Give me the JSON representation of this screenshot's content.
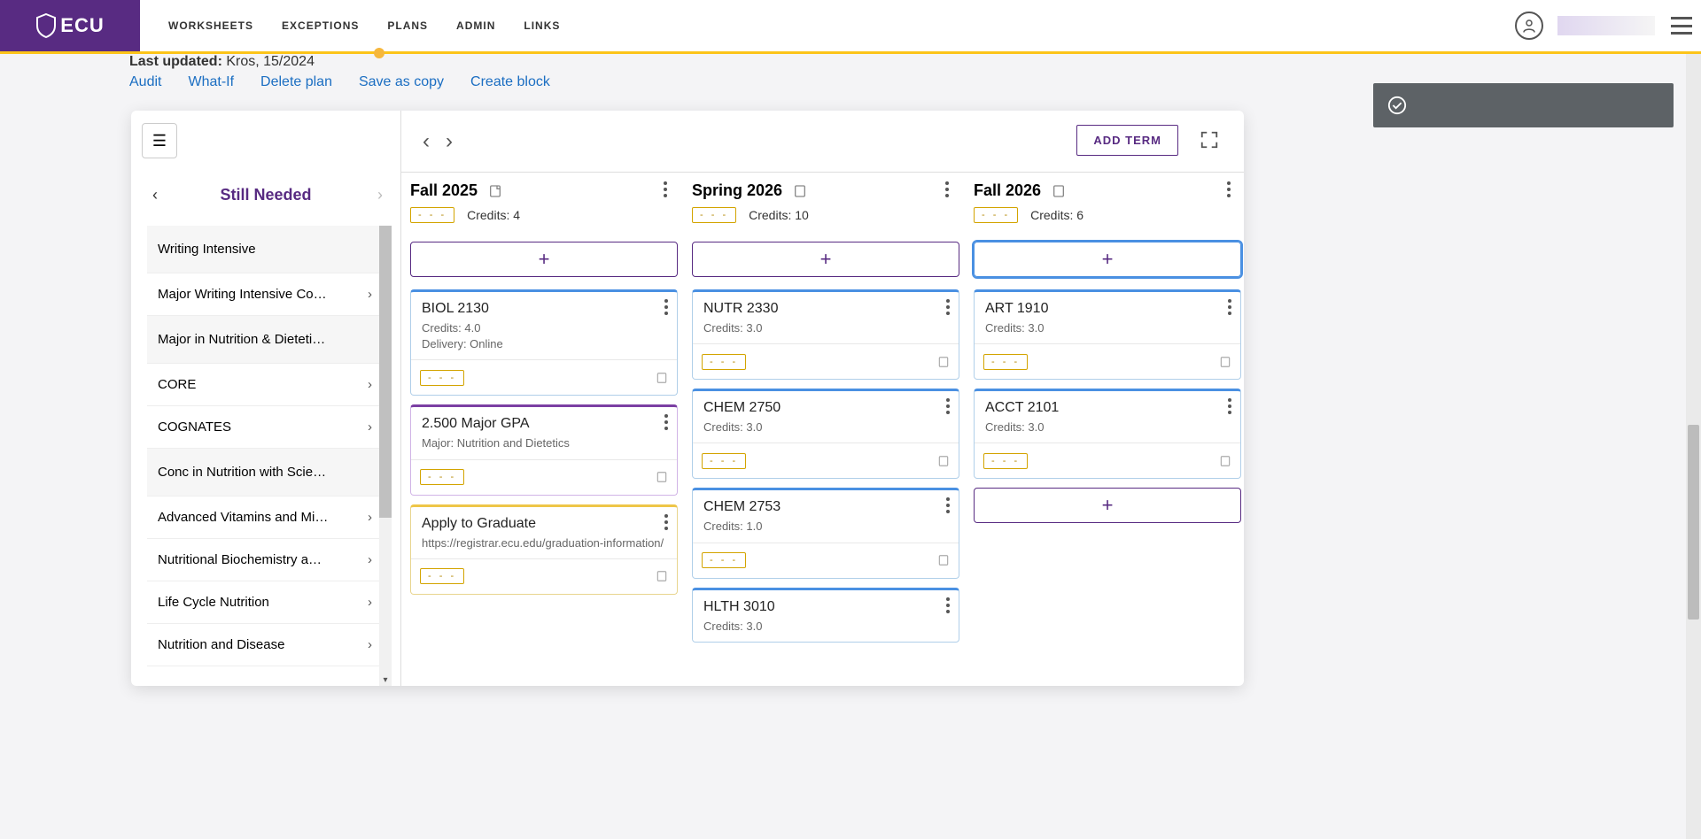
{
  "brand": {
    "text": "ECU"
  },
  "nav": {
    "worksheets": "WORKSHEETS",
    "exceptions": "EXCEPTIONS",
    "plans": "PLANS",
    "admin": "ADMIN",
    "links": "LINKS"
  },
  "subheader": {
    "last_updated_label": "Last updated:",
    "last_updated_value": "Kros,                           15/2024"
  },
  "actions": {
    "audit": "Audit",
    "whatif": "What-If",
    "delete": "Delete plan",
    "save": "Save as copy",
    "create": "Create block"
  },
  "sidebar": {
    "title": "Still Needed",
    "groups": [
      {
        "label": "Writing Intensive",
        "items": [
          {
            "label": "Major Writing Intensive Co…"
          }
        ]
      },
      {
        "label": "Major in Nutrition & Dieteti…",
        "items": [
          {
            "label": "CORE"
          },
          {
            "label": "COGNATES"
          }
        ]
      },
      {
        "label": "Conc in Nutrition with Scie…",
        "items": [
          {
            "label": "Advanced Vitamins and Mi…"
          },
          {
            "label": "Nutritional Biochemistry a…"
          },
          {
            "label": "Life Cycle Nutrition"
          },
          {
            "label": "Nutrition and Disease"
          }
        ]
      }
    ]
  },
  "toolbar": {
    "add_term": "ADD TERM"
  },
  "dash": "- - -",
  "credits_word": "Credits:",
  "terms": [
    {
      "title": "Fall 2025",
      "credits": "4",
      "cards": [
        {
          "type": "course",
          "title": "BIOL 2130",
          "sub1": "Credits: 4.0",
          "sub2": "Delivery: Online"
        },
        {
          "type": "gpa",
          "title": "2.500 Major GPA",
          "sub1": "Major: Nutrition and Dietetics",
          "sub2": ""
        },
        {
          "type": "task",
          "title": "Apply to Graduate",
          "sub1": "https://registrar.ecu.edu/graduation-information/",
          "sub2": ""
        }
      ]
    },
    {
      "title": "Spring 2026",
      "credits": "10",
      "cards": [
        {
          "type": "course",
          "title": "NUTR 2330",
          "sub1": "Credits: 3.0",
          "sub2": ""
        },
        {
          "type": "course",
          "title": "CHEM 2750",
          "sub1": "Credits: 3.0",
          "sub2": ""
        },
        {
          "type": "course",
          "title": "CHEM 2753",
          "sub1": "Credits: 1.0",
          "sub2": ""
        },
        {
          "type": "course",
          "title": "HLTH 3010",
          "sub1": "Credits: 3.0",
          "sub2": ""
        }
      ]
    },
    {
      "title": "Fall 2026",
      "credits": "6",
      "cards": [
        {
          "type": "course",
          "title": "ART 1910",
          "sub1": "Credits: 3.0",
          "sub2": ""
        },
        {
          "type": "course",
          "title": "ACCT 2101",
          "sub1": "Credits: 3.0",
          "sub2": ""
        }
      ]
    }
  ]
}
